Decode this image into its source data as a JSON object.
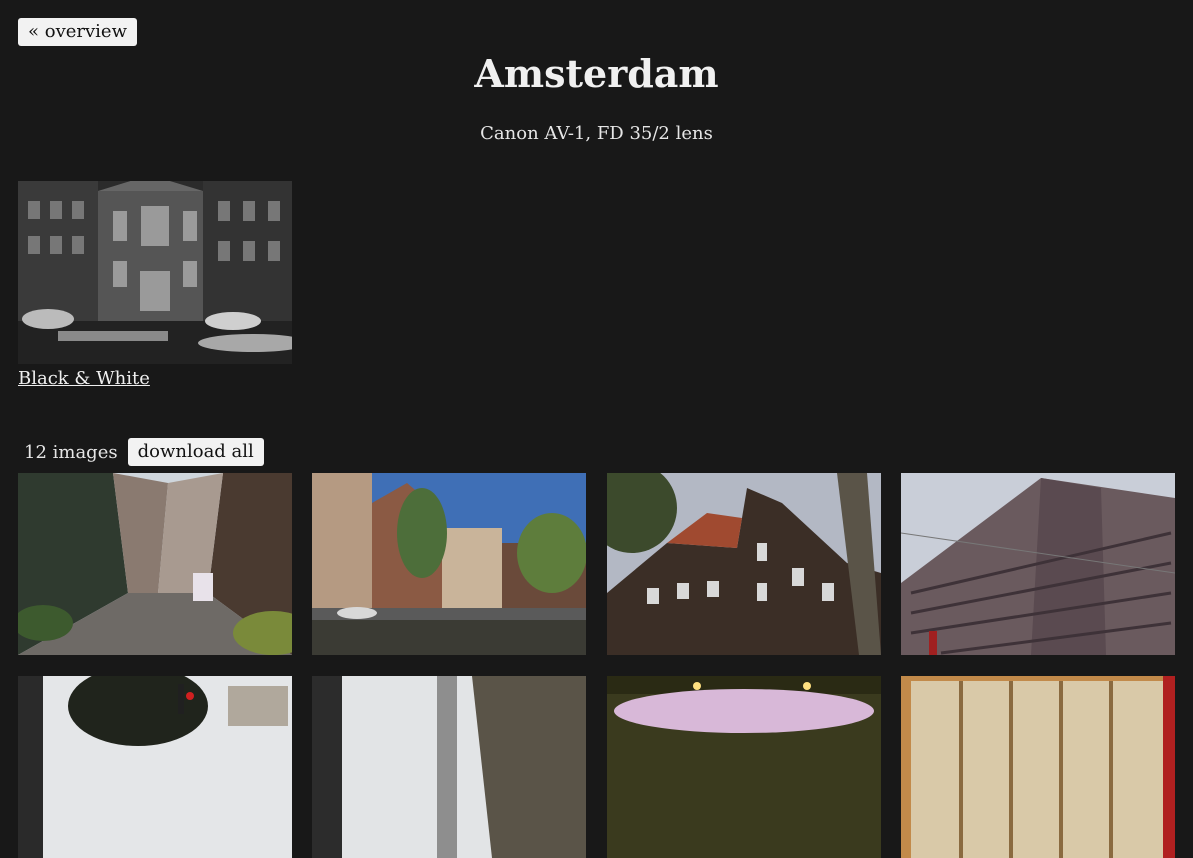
{
  "nav": {
    "back_label": "« overview"
  },
  "header": {
    "title": "Amsterdam",
    "subtitle": "Canon AV-1, FD 35/2 lens"
  },
  "albums": [
    {
      "label": "Black & White"
    }
  ],
  "gallery": {
    "count_label": "12 images",
    "download_label": "download all"
  }
}
